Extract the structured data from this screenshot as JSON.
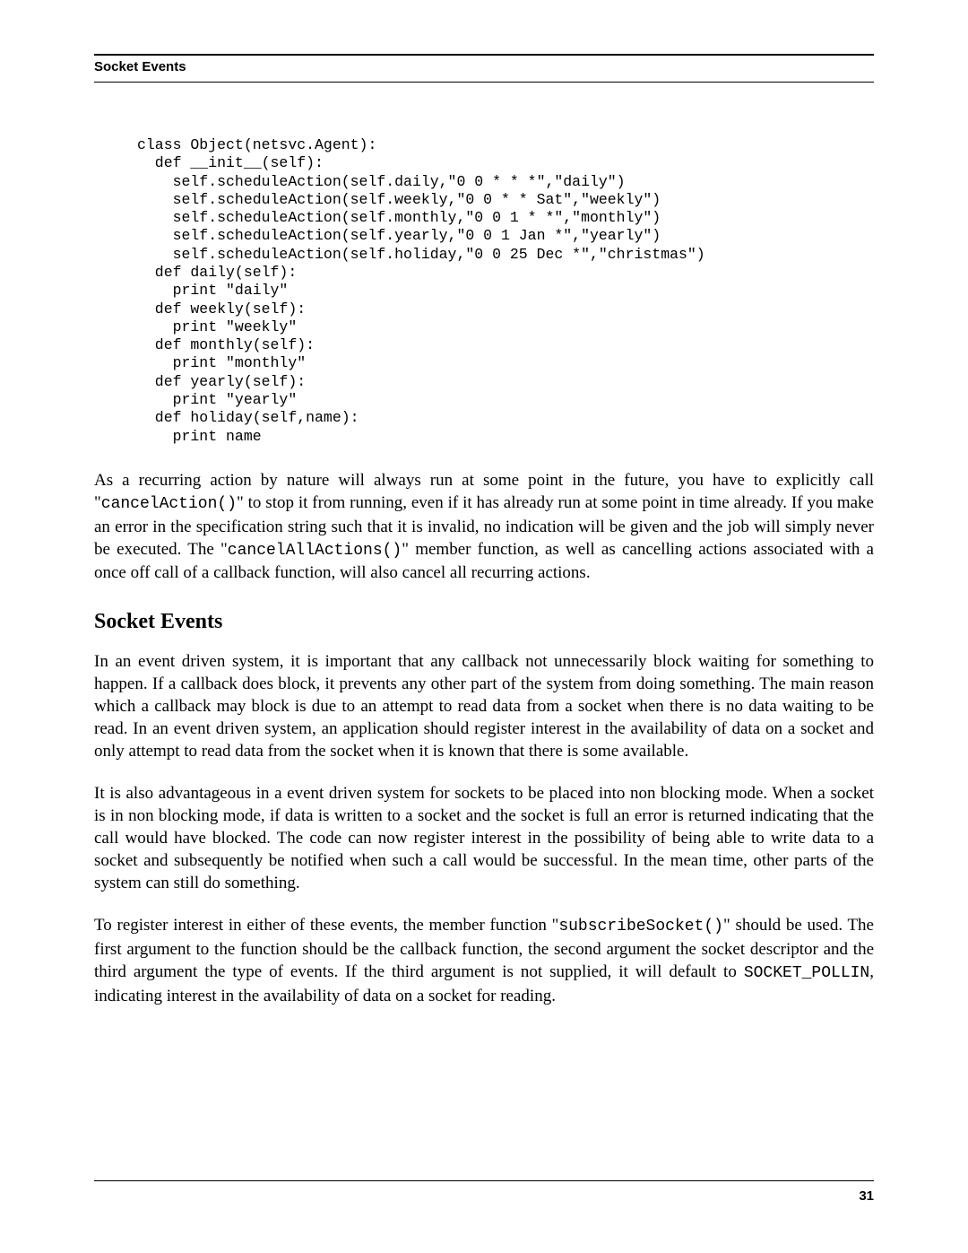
{
  "header": {
    "running_title": "Socket Events"
  },
  "code": {
    "block1": "class Object(netsvc.Agent):\n  def __init__(self):\n    self.scheduleAction(self.daily,\"0 0 * * *\",\"daily\")\n    self.scheduleAction(self.weekly,\"0 0 * * Sat\",\"weekly\")\n    self.scheduleAction(self.monthly,\"0 0 1 * *\",\"monthly\")\n    self.scheduleAction(self.yearly,\"0 0 1 Jan *\",\"yearly\")\n    self.scheduleAction(self.holiday,\"0 0 25 Dec *\",\"christmas\")\n  def daily(self):\n    print \"daily\"\n  def weekly(self):\n    print \"weekly\"\n  def monthly(self):\n    print \"monthly\"\n  def yearly(self):\n    print \"yearly\"\n  def holiday(self,name):\n    print name"
  },
  "paragraphs": {
    "p1_a": "As a recurring action by nature will always run at some point in the future, you have to explicitly call \"",
    "p1_code1": "cancelAction()",
    "p1_b": "\" to stop it from running, even if it has already run at some point in time already. If you make an error in the specification string such that it is invalid, no indication will be given and the job will simply never be executed. The \"",
    "p1_code2": "cancelAllActions()",
    "p1_c": "\" member function, as well as cancelling actions associated with a once off call of a callback function, will also cancel all recurring actions.",
    "p2": "In an event driven system, it is important that any callback not unnecessarily block waiting for something to happen. If a callback does block, it prevents any other part of the system from doing something. The main reason which a callback may block is due to an attempt to read data from a socket when there is no data waiting to be read. In an event driven system, an application should register interest in the availability of data on a socket and only attempt to read data from the socket when it is known that there is some available.",
    "p3": "It is also advantageous in a event driven system for sockets to be placed into non blocking mode. When a socket is in non blocking mode, if data is written to a socket and the socket is full an error is returned indicating that the call would have blocked. The code can now register interest in the possibility of being able to write data to a socket and subsequently be notified when such a call would be successful. In the mean time, other parts of the system can still do something.",
    "p4_a": "To register interest in either of these events, the member function \"",
    "p4_code1": "subscribeSocket()",
    "p4_b": "\" should be used. The first argument to the function should be the callback function, the second argument the socket descriptor and the third argument the type of events. If the third argument is not supplied, it will default to ",
    "p4_code2": "SOCKET_POLLIN",
    "p4_c": ", indicating interest in the availability of data on a socket for reading."
  },
  "section": {
    "title": "Socket Events"
  },
  "footer": {
    "page_number": "31"
  }
}
